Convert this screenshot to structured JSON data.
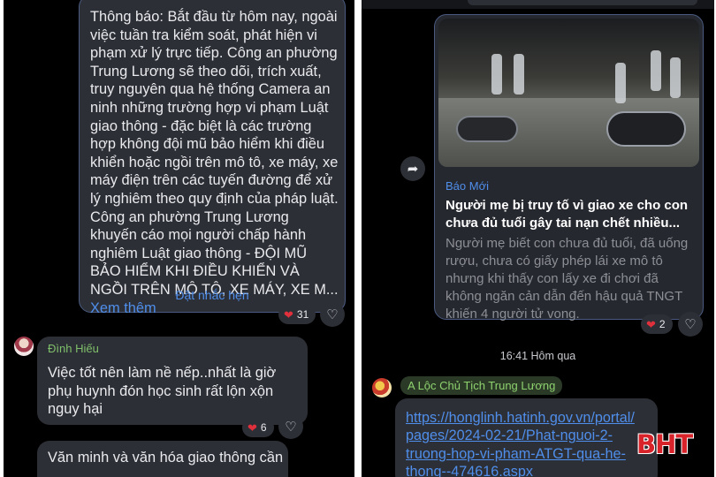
{
  "left": {
    "announcement": {
      "text": "Thông báo: Bắt đầu từ hôm nay, ngoài việc tuần tra kiểm soát, phát hiện vi phạm xử lý trực tiếp. Công an phường Trung Lương sẽ theo dõi, trích xuất, truy nguyên qua hệ thống Camera an ninh những trường hợp vi phạm Luật giao thông - đặc biệt là các trường hợp không đội mũ bảo hiểm khi điều khiển hoặc ngồi trên mô tô, xe máy, xe máy điện trên các tuyến đường để xử lý nghiêm theo quy định của pháp luật. Công an phường Trung Lương khuyến cáo mọi người chấp hành nghiêm Luật giao thông - ĐỘI MŨ BẢO HIỂM KHI ĐIỀU KHIỂN VÀ NGỒI TRÊN MÔ TÔ, XE MÁY, XE M...",
      "see_more": "Xem thêm",
      "remind": "Đặt nhắc hẹn",
      "reaction_count": "31"
    },
    "reply": {
      "sender": "Đình Hiếu",
      "text": "Việc tốt nên làm nề nếp..nhất là giờ phụ huynh đón học sinh rất lộn xộn nguy hại",
      "reaction_count": "6"
    },
    "next_message": {
      "text": "Văn minh và văn hóa giao thông cần chấn chỉnh. Tuyên truyền... và xử lý"
    }
  },
  "right": {
    "card": {
      "source": "Báo Mới",
      "title": "Người mẹ bị truy tố vì giao xe cho con chưa đủ tuổi gây tai nạn chết nhiều...",
      "description": "Người mẹ biết con chưa đủ tuổi, đã uống rượu, chưa có giấy phép lái xe mô tô nhưng khi thấy con lấy xe đi chơi đã không ngăn cản dẫn đến hậu quả TNGT khiến 4 người tử vong.",
      "reaction_count": "2"
    },
    "timestamp": "16:41 Hôm qua",
    "sender": "A Lộc Chủ Tịch Trung Lương",
    "link": "https://honglinh.hatinh.gov.vn/portal/\npages/2024-02-21/Phat-nguoi-2-\ntruong-hop-vi-pham-ATGT-qua-he-\nthong--474616.aspx"
  },
  "watermark": "BHT",
  "icons": {
    "heart": "heart-icon",
    "like": "heart-outline-icon",
    "share": "share-arrow-icon"
  },
  "colors": {
    "background": "#000000",
    "bubble": "#2d2f36",
    "link": "#4f8eea",
    "sender_name": "#7fbf6a",
    "heart": "#e0303c",
    "watermark": "#d8232a"
  }
}
